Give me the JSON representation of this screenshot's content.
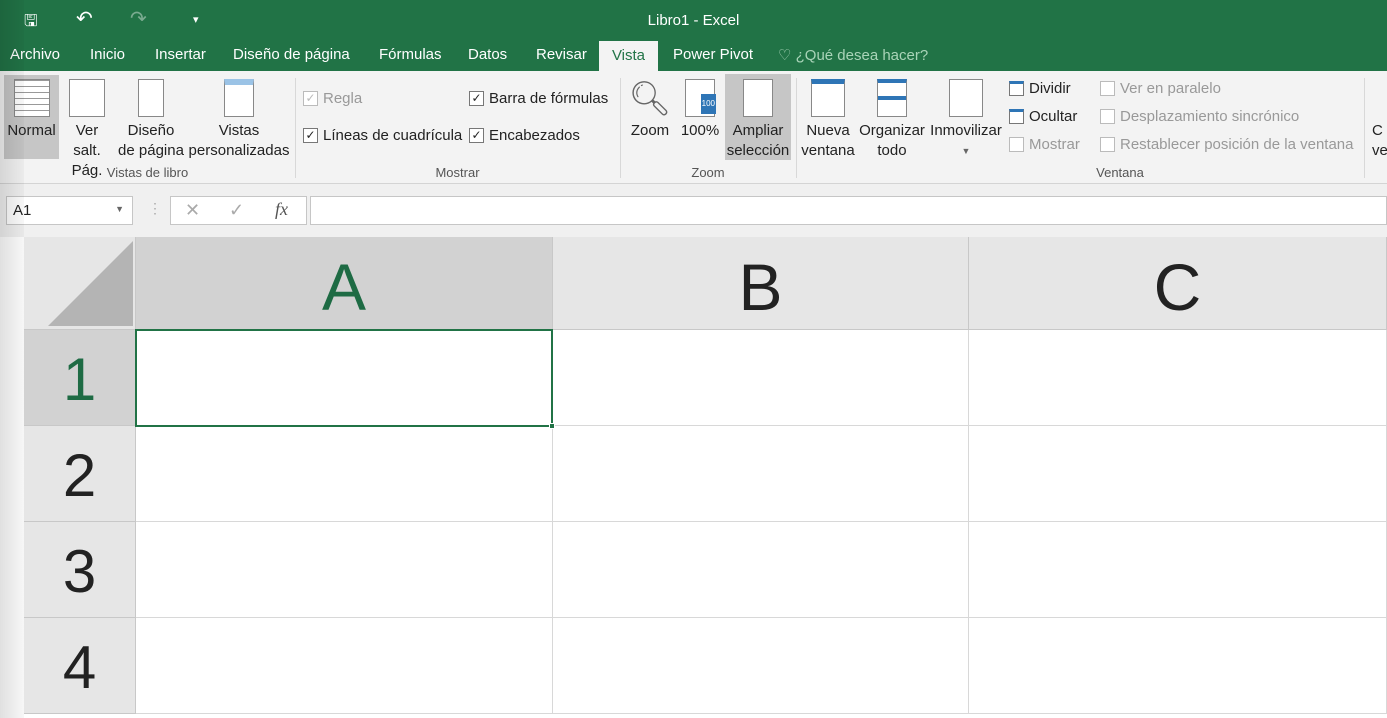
{
  "window": {
    "title": "Libro1 - Excel"
  },
  "quick_access": {
    "save": "🖫",
    "undo": "↶",
    "redo": "↷",
    "customize": "▾"
  },
  "tabs": [
    "Archivo",
    "Inicio",
    "Insertar",
    "Diseño de página",
    "Fórmulas",
    "Datos",
    "Revisar",
    "Vista",
    "Power Pivot"
  ],
  "active_tab": "Vista",
  "tell_me": "¿Qué desea hacer?",
  "ribbon": {
    "vistas": {
      "label": "Vistas de libro",
      "normal": "Normal",
      "ver_salt_1": "Ver salt.",
      "ver_salt_2": "Pág.",
      "diseno_1": "Diseño",
      "diseno_2": "de página",
      "vistas_1": "Vistas",
      "vistas_2": "personalizadas"
    },
    "mostrar": {
      "label": "Mostrar",
      "regla": "Regla",
      "lineas": "Líneas de cuadrícula",
      "barra": "Barra de fórmulas",
      "encabezados": "Encabezados"
    },
    "zoom": {
      "label": "Zoom",
      "zoom": "Zoom",
      "pct": "100%",
      "ampliar_1": "Ampliar",
      "ampliar_2": "selección",
      "badge": "100"
    },
    "ventana": {
      "label": "Ventana",
      "nueva_1": "Nueva",
      "nueva_2": "ventana",
      "org_1": "Organizar",
      "org_2": "todo",
      "inmov": "Inmovilizar",
      "dividir": "Dividir",
      "ocultar": "Ocultar",
      "mostrar": "Mostrar",
      "paralelo": "Ver en paralelo",
      "desplaz": "Desplazamiento sincrónico",
      "restablecer": "Restablecer posición de la ventana",
      "cambiar_1": "C",
      "cambiar_2": "ve"
    }
  },
  "formula_bar": {
    "name_box": "A1",
    "cancel": "✕",
    "enter": "✓",
    "fx": "fx",
    "value": ""
  },
  "sheet": {
    "columns": [
      "A",
      "B",
      "C"
    ],
    "rows": [
      "1",
      "2",
      "3",
      "4"
    ],
    "selected": "A1",
    "accent": "#217346"
  }
}
